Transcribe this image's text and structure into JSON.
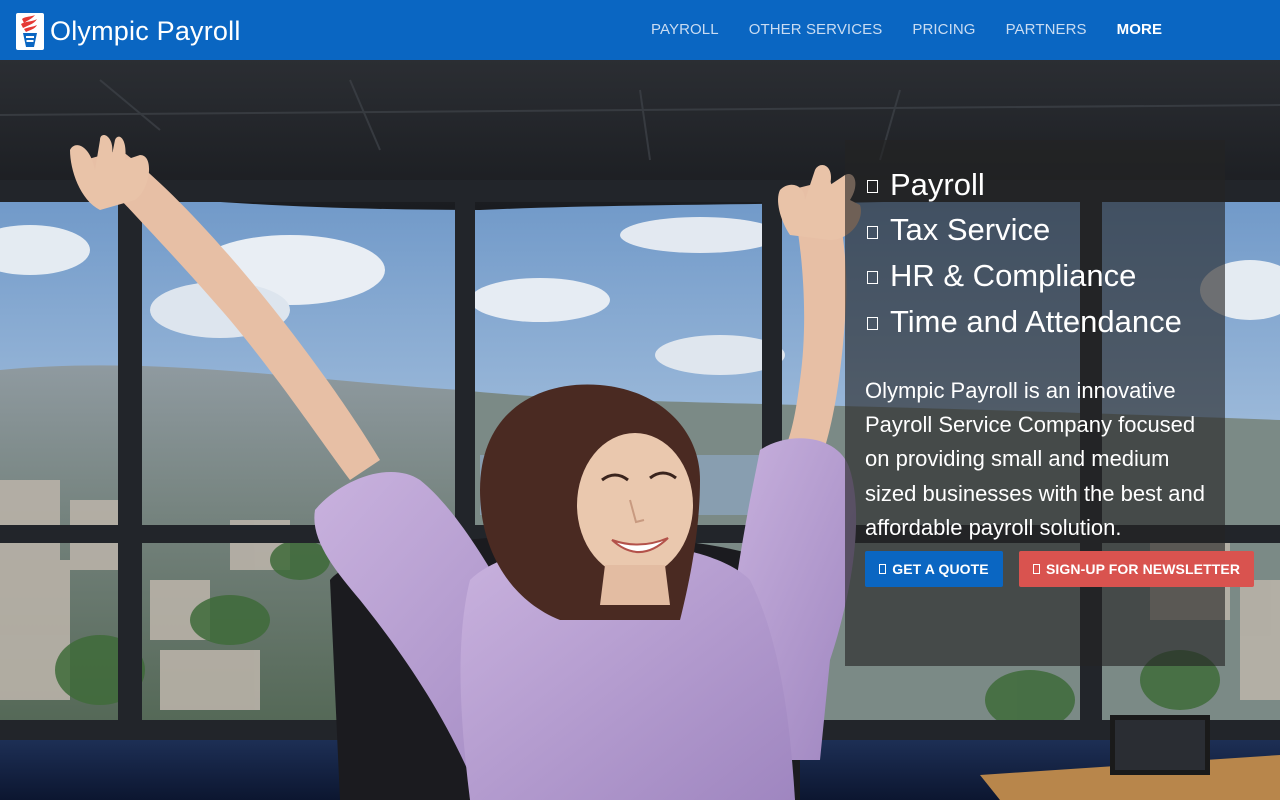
{
  "brand": {
    "name": "Olympic Payroll",
    "logo_icon": "olympic-torch-logo"
  },
  "nav": {
    "items": [
      {
        "label": "PAYROLL"
      },
      {
        "label": "OTHER SERVICES"
      },
      {
        "label": "PRICING"
      },
      {
        "label": "PARTNERS"
      },
      {
        "label": "MORE"
      }
    ]
  },
  "hero": {
    "services": [
      {
        "label": "Payroll",
        "icon": "check-square-icon"
      },
      {
        "label": "Tax Service",
        "icon": "check-square-icon"
      },
      {
        "label": "HR & Compliance",
        "icon": "check-square-icon"
      },
      {
        "label": "Time and Attendance",
        "icon": "check-square-icon"
      }
    ],
    "description": "Olympic Payroll is an innovative Payroll Service Company focused on providing small and medium sized businesses with the best and affordable payroll solution.",
    "quote_button": "GET A QUOTE",
    "newsletter_button": "SIGN-UP FOR NEWSLETTER"
  },
  "colors": {
    "nav_bg": "#0a66c2",
    "primary_button": "#0a66c2",
    "danger_button": "#d9534f"
  }
}
